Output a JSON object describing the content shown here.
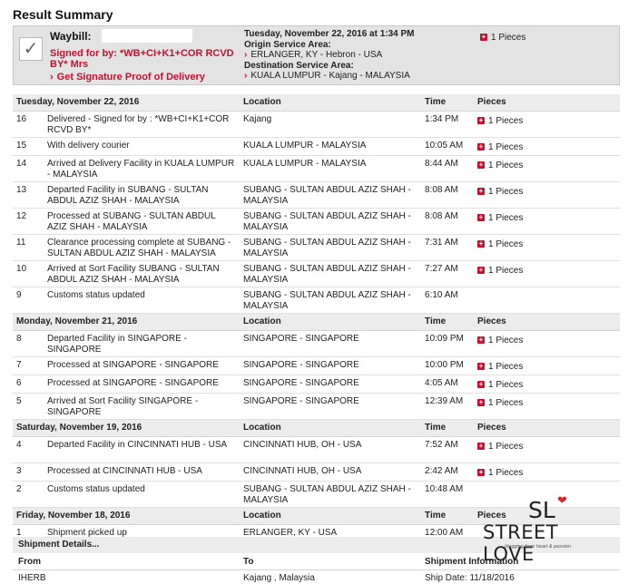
{
  "page": {
    "title": "Result Summary"
  },
  "summary": {
    "waybill_label": "Waybill:",
    "signed_line": "Signed for by: *WB+CI+K1+COR RCVD BY* Mrs",
    "proof_link": "Get Signature Proof of Delivery",
    "datetime": "Tuesday, November 22, 2016 at 1:34 PM",
    "origin_label": "Origin Service Area:",
    "origin_value": "ERLANGER, KY - Hebron - USA",
    "destination_label": "Destination Service Area:",
    "destination_value": "KUALA LUMPUR - Kajang - MALAYSIA",
    "pieces": "1 Pieces"
  },
  "columns": {
    "location": "Location",
    "time": "Time",
    "pieces": "Pieces"
  },
  "groups": [
    {
      "date": "Tuesday, November 22, 2016",
      "events": [
        {
          "n": "16",
          "desc": "Delivered - Signed for by : *WB+CI+K1+COR RCVD BY*",
          "loc": "Kajang",
          "time": "1:34 PM",
          "pieces": "1 Pieces"
        },
        {
          "n": "15",
          "desc": "With delivery courier",
          "loc": "KUALA LUMPUR - MALAYSIA",
          "time": "10:05 AM",
          "pieces": "1 Pieces"
        },
        {
          "n": "14",
          "desc": "Arrived at Delivery Facility in KUALA LUMPUR - MALAYSIA",
          "loc": "KUALA LUMPUR - MALAYSIA",
          "time": "8:44 AM",
          "pieces": "1 Pieces"
        },
        {
          "n": "13",
          "desc": "Departed Facility in SUBANG - SULTAN ABDUL AZIZ SHAH - MALAYSIA",
          "loc": "SUBANG - SULTAN ABDUL AZIZ SHAH - MALAYSIA",
          "time": "8:08 AM",
          "pieces": "1 Pieces"
        },
        {
          "n": "12",
          "desc": "Processed at SUBANG - SULTAN ABDUL AZIZ SHAH - MALAYSIA",
          "loc": "SUBANG - SULTAN ABDUL AZIZ SHAH - MALAYSIA",
          "time": "8:08 AM",
          "pieces": "1 Pieces"
        },
        {
          "n": "11",
          "desc": "Clearance processing complete at SUBANG - SULTAN ABDUL AZIZ SHAH - MALAYSIA",
          "loc": "SUBANG - SULTAN ABDUL AZIZ SHAH - MALAYSIA",
          "time": "7:31 AM",
          "pieces": "1 Pieces"
        },
        {
          "n": "10",
          "desc": "Arrived at Sort Facility SUBANG - SULTAN ABDUL AZIZ SHAH - MALAYSIA",
          "loc": "SUBANG - SULTAN ABDUL AZIZ SHAH - MALAYSIA",
          "time": "7:27 AM",
          "pieces": "1 Pieces"
        },
        {
          "n": "9",
          "desc": "Customs status updated",
          "loc": "SUBANG - SULTAN ABDUL AZIZ SHAH - MALAYSIA",
          "time": "6:10 AM",
          "pieces": ""
        }
      ]
    },
    {
      "date": "Monday, November 21, 2016",
      "events": [
        {
          "n": "8",
          "desc": "Departed Facility in SINGAPORE - SINGAPORE",
          "loc": "SINGAPORE - SINGAPORE",
          "time": "10:09 PM",
          "pieces": "1 Pieces"
        },
        {
          "n": "7",
          "desc": "Processed at SINGAPORE - SINGAPORE",
          "loc": "SINGAPORE - SINGAPORE",
          "time": "10:00 PM",
          "pieces": "1 Pieces"
        },
        {
          "n": "6",
          "desc": "Processed at SINGAPORE - SINGAPORE",
          "loc": "SINGAPORE - SINGAPORE",
          "time": "4:05 AM",
          "pieces": "1 Pieces"
        },
        {
          "n": "5",
          "desc": "Arrived at Sort Facility SINGAPORE - SINGAPORE",
          "loc": "SINGAPORE - SINGAPORE",
          "time": "12:39 AM",
          "pieces": "1 Pieces"
        }
      ]
    },
    {
      "date": "Saturday, November 19, 2016",
      "events": [
        {
          "n": "4",
          "desc": "Departed Facility in CINCINNATI HUB - USA",
          "loc": "CINCINNATI HUB, OH - USA",
          "time": "7:52 AM",
          "pieces": "1 Pieces"
        },
        {
          "n": "3",
          "desc": "Processed at CINCINNATI HUB - USA",
          "loc": "CINCINNATI HUB, OH - USA",
          "time": "2:42 AM",
          "pieces": "1 Pieces"
        },
        {
          "n": "2",
          "desc": "Customs status updated",
          "loc": "SUBANG - SULTAN ABDUL AZIZ SHAH - MALAYSIA",
          "time": "10:48 AM",
          "pieces": ""
        }
      ]
    },
    {
      "date": "Friday, November 18, 2016",
      "events": [
        {
          "n": "1",
          "desc": "Shipment picked up",
          "loc": "ERLANGER, KY - USA",
          "time": "12:00 AM",
          "pieces": ""
        }
      ]
    }
  ],
  "shipment": {
    "section_label": "Shipment Details...",
    "col_from": "From",
    "col_to": "To",
    "col_info": "Shipment Information",
    "from": "IHERB",
    "to": "Kajang , Malaysia",
    "info": "Ship Date: 11/18/2016"
  },
  "watermark": {
    "monogram": "SL",
    "name": "STREET LOVE",
    "tagline": "blogging from heart & passion",
    "heart_color": "#e0242f"
  }
}
